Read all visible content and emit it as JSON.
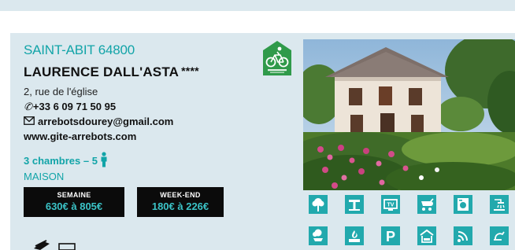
{
  "listing": {
    "location": "SAINT-ABIT 64800",
    "owner": "LAURENCE DALL'ASTA",
    "stars": "****",
    "address": "2, rue de l'église",
    "phone_icon": "phone-icon",
    "phone": "+33 6 09 71 50 95",
    "email_icon": "envelope-icon",
    "email": "arrebotsdourey@gmail.com",
    "website": "www.gite-arrebots.com",
    "rooms": "3 chambres – 5",
    "person_icon": "person-icon",
    "type": "MAISON",
    "label_badge_icon": "cycling-label-icon"
  },
  "prices": [
    {
      "label": "SEMAINE",
      "value": "630€ à 805€"
    },
    {
      "label": "WEEK-END",
      "value": "180€ à 226€"
    }
  ],
  "amenities": {
    "row1": [
      "garden-icon",
      "ironing-icon",
      "tv-icon",
      "baby-stroller-icon",
      "washing-machine-icon",
      "shower-icon"
    ],
    "row2": [
      "barbecue-icon",
      "fireplace-icon",
      "parking-icon",
      "garage-icon",
      "wifi-icon",
      "accessibility-icon"
    ]
  },
  "colors": {
    "card_bg": "#dbe8ee",
    "accent": "#12a4a8",
    "icon_tile": "#22a9ad",
    "price_bg": "#0b0b0b",
    "price_value": "#3bc3c7"
  }
}
